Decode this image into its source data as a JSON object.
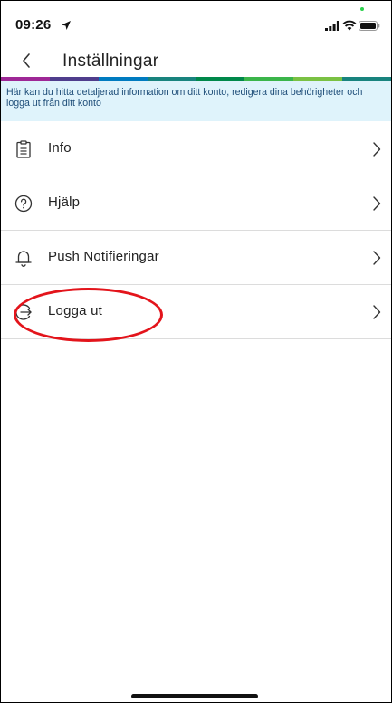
{
  "status_bar": {
    "time": "09:26",
    "icons": [
      "location-arrow-icon",
      "signal-icon",
      "wifi-icon",
      "battery-icon"
    ]
  },
  "nav": {
    "title": "Inställningar",
    "back_icon": "chevron-left-icon"
  },
  "rainbow_colors": [
    "#9e2896",
    "#4f3d8c",
    "#007bc0",
    "#18837e",
    "#00884a",
    "#3bb54a",
    "#7ac143",
    "#18837e"
  ],
  "banner": {
    "text": "Här kan du hitta detaljerad information om ditt konto, redigera dina behörigheter och logga ut från ditt konto"
  },
  "menu": {
    "items": [
      {
        "label": "Info",
        "icon": "clipboard-icon"
      },
      {
        "label": "Hjälp",
        "icon": "help-circle-icon"
      },
      {
        "label": "Push Notifieringar",
        "icon": "bell-icon"
      },
      {
        "label": "Logga ut",
        "icon": "logout-icon"
      }
    ]
  },
  "colors": {
    "banner_bg": "#dff3fb",
    "banner_text": "#1f4e79",
    "annotation": "#e3141b",
    "divider": "#dcdcdc"
  }
}
